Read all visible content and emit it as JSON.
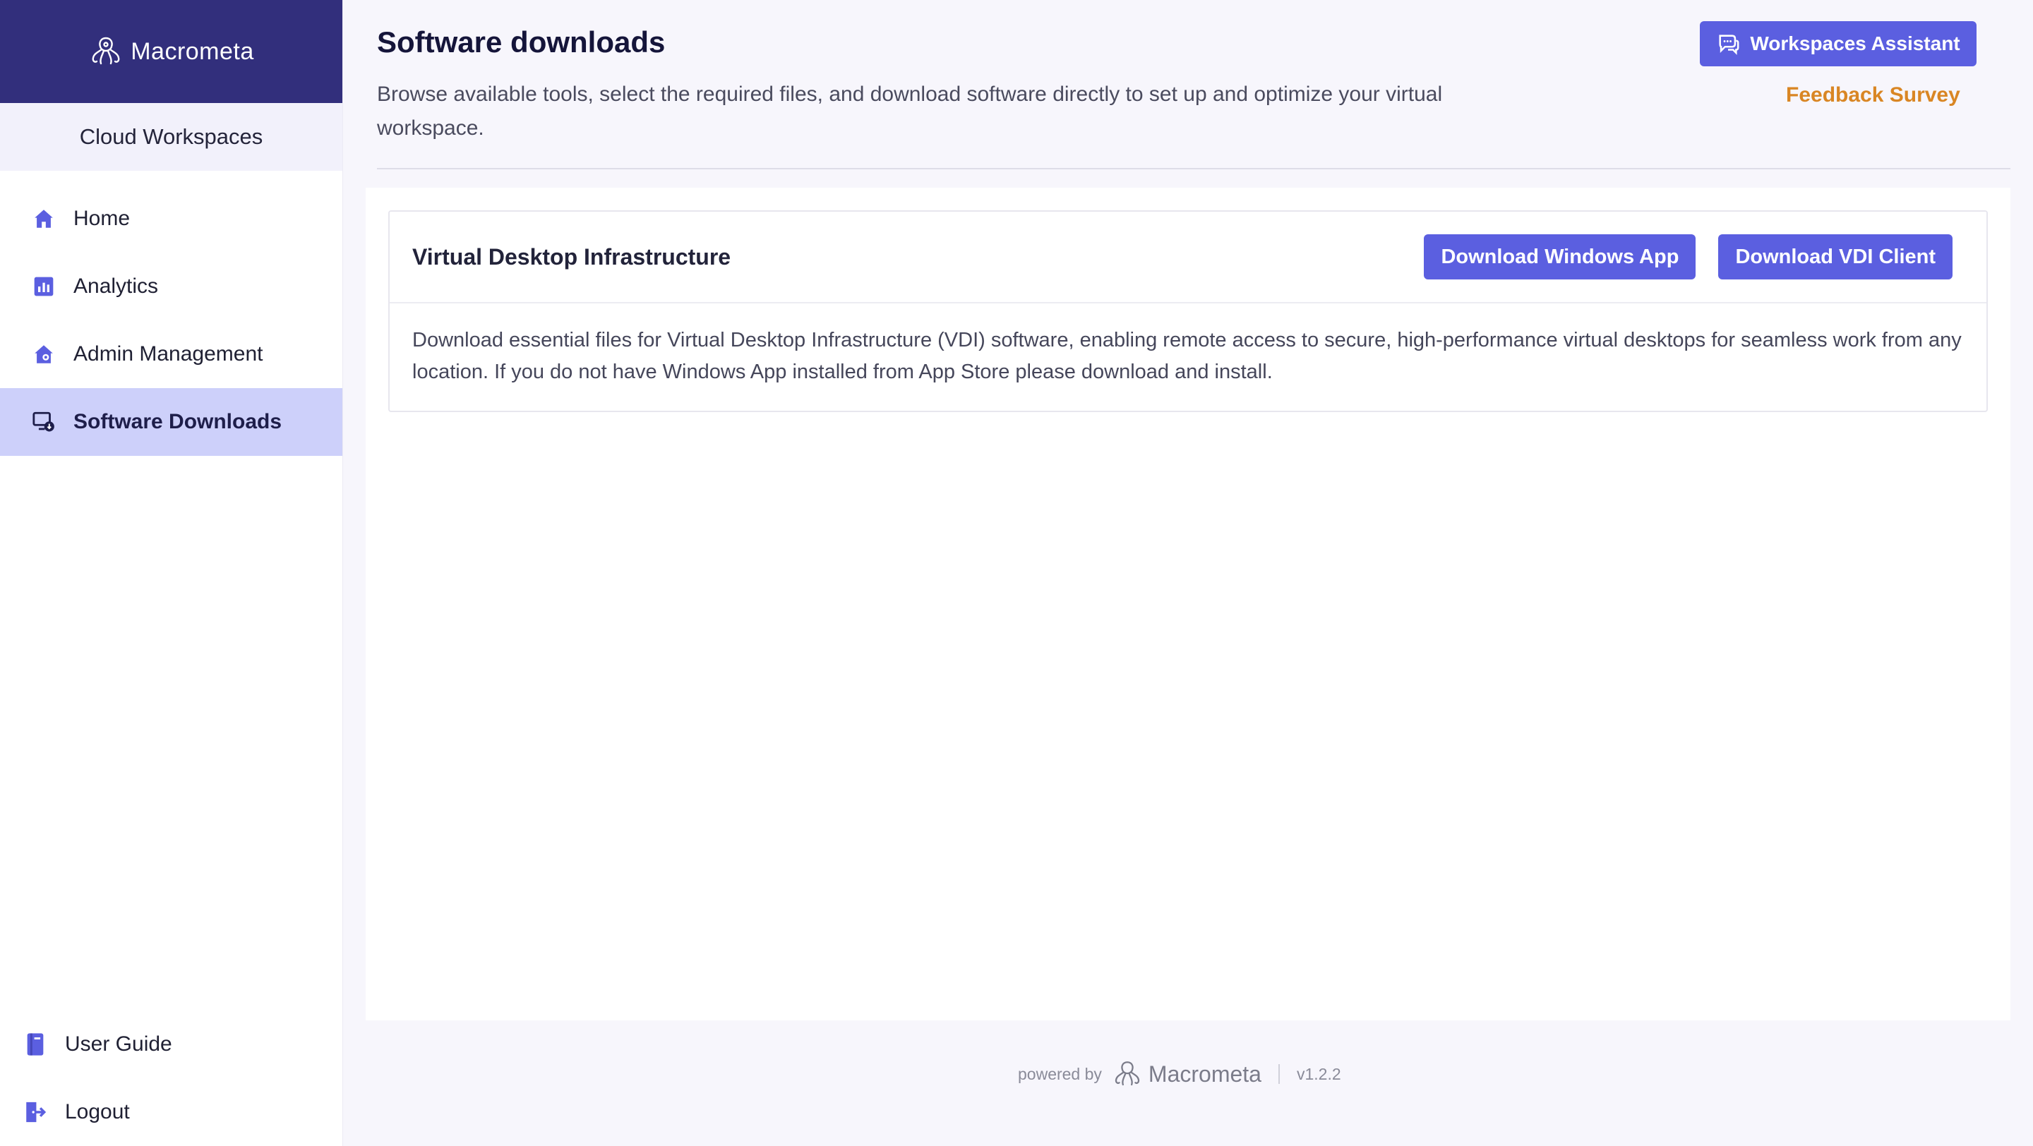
{
  "brand": {
    "name": "Macrometa"
  },
  "workspace": {
    "name": "Cloud Workspaces"
  },
  "sidebar": {
    "items": [
      {
        "label": "Home",
        "icon": "home-icon"
      },
      {
        "label": "Analytics",
        "icon": "analytics-icon"
      },
      {
        "label": "Admin Management",
        "icon": "admin-icon"
      },
      {
        "label": "Software Downloads",
        "icon": "software-downloads-icon",
        "active": true
      }
    ],
    "bottom_items": [
      {
        "label": "User Guide",
        "icon": "book-icon"
      },
      {
        "label": "Logout",
        "icon": "logout-icon"
      }
    ]
  },
  "header": {
    "title": "Software downloads",
    "description": "Browse available tools, select the required files, and download software directly to set up and optimize your virtual workspace.",
    "assistant_label": "Workspaces Assistant",
    "feedback_label": "Feedback Survey"
  },
  "card": {
    "title": "Virtual Desktop Infrastructure",
    "download_windows_label": "Download Windows App",
    "download_vdi_label": "Download VDI Client",
    "description": "Download essential files for Virtual Desktop Infrastructure (VDI) software, enabling remote access to secure, high-performance virtual desktops for seamless work from any location. If you do not have Windows App installed from App Store please download and install."
  },
  "footer": {
    "powered_by": "powered by",
    "brand": "Macrometa",
    "version": "v1.2.2"
  },
  "colors": {
    "brand_dark": "#322f7c",
    "accent": "#5b5fe0",
    "active_nav": "#cdd0fa",
    "feedback": "#d98624"
  }
}
